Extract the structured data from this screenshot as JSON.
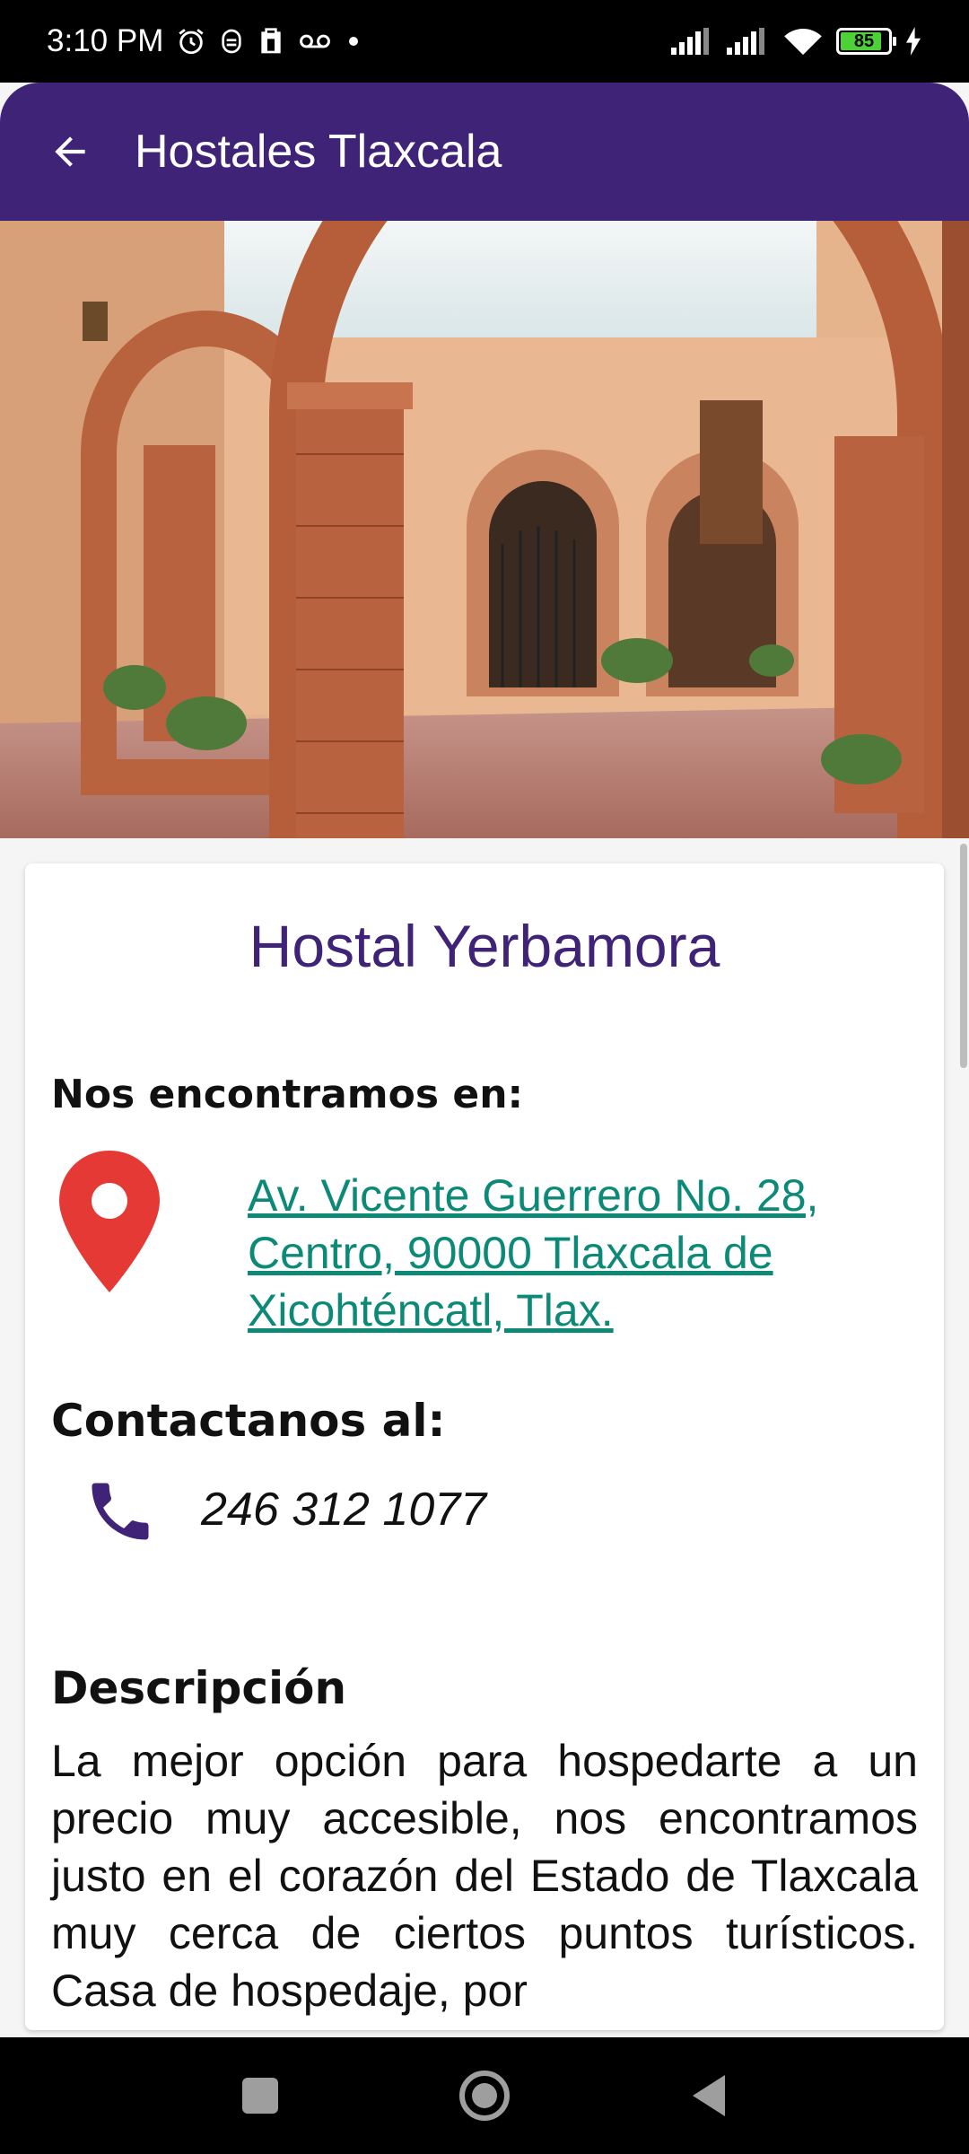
{
  "status_bar": {
    "time": "3:10 PM",
    "battery_level": "85",
    "icons": [
      "alarm-icon",
      "notification-icon",
      "clipboard-icon",
      "voicemail-icon",
      "dot-icon",
      "signal-icon",
      "signal-icon",
      "wifi-icon",
      "battery-icon",
      "charging-icon"
    ]
  },
  "app_bar": {
    "back_icon": "arrow-back-icon",
    "title": "Hostales Tlaxcala",
    "background": "#3e2377"
  },
  "hero": {
    "image": "hostal-courtyard-photo"
  },
  "details": {
    "name": "Hostal Yerbamora",
    "location_heading": "Nos encontramos en:",
    "location_icon": "map-pin-icon",
    "address": " Av. Vicente Guerrero No. 28, Centro, 90000 Tlaxcala de Xicohténcatl, Tlax. ",
    "contact_heading": "Contactanos al:",
    "phone_icon": "phone-icon",
    "phone": "246 312 1077",
    "description_heading": "Descripción",
    "description": "La mejor opción para hospedarte a un precio muy accesible, nos encontramos justo en el corazón del Estado de Tlaxcala muy cerca de ciertos puntos turísticos. Casa de hospedaje, por"
  },
  "colors": {
    "accent": "#3e2377",
    "link": "#0d8a77",
    "pin": "#e53935"
  },
  "nav_bar": {
    "buttons": [
      "recents-icon",
      "home-icon",
      "back-icon"
    ]
  }
}
